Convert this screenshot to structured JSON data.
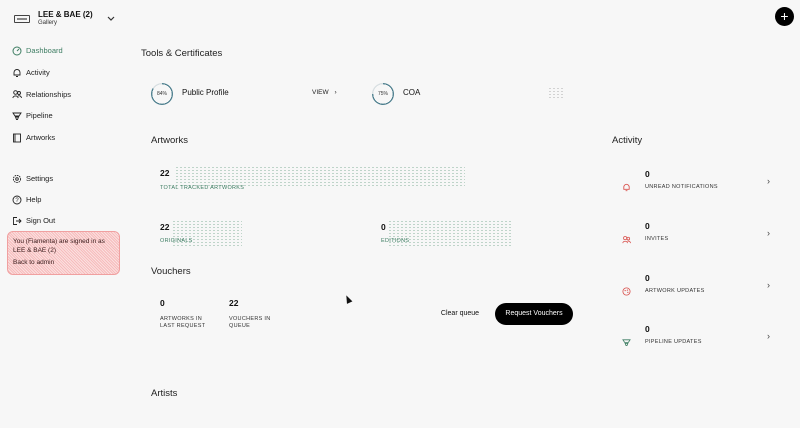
{
  "gallery": {
    "name": "LEE & BAE (2)",
    "subtitle": "Gallery"
  },
  "nav": {
    "primary": [
      {
        "label": "Dashboard",
        "icon": "dashboard-icon",
        "active": true
      },
      {
        "label": "Activity",
        "icon": "bell-icon"
      },
      {
        "label": "Relationships",
        "icon": "users-icon"
      },
      {
        "label": "Pipeline",
        "icon": "pipeline-icon"
      },
      {
        "label": "Artworks",
        "icon": "book-icon"
      }
    ],
    "secondary": [
      {
        "label": "Settings",
        "icon": "gear-icon"
      },
      {
        "label": "Help",
        "icon": "help-icon"
      },
      {
        "label": "Sign Out",
        "icon": "sign-out-icon"
      }
    ]
  },
  "signed_in": {
    "message": "You (Fiamenta) are signed in as LEE & BAE (2)",
    "back_label": "Back to admin"
  },
  "tools": {
    "title": "Tools & Certificates",
    "public_profile": {
      "percent": "84%",
      "percent_value": 84,
      "label": "Public Profile",
      "view_label": "VIEW"
    },
    "coa": {
      "percent": "75%",
      "percent_value": 75,
      "label": "COA"
    }
  },
  "artworks": {
    "title": "Artworks",
    "total": {
      "value": "22",
      "label": "TOTAL TRACKED ARTWORKS"
    },
    "originals": {
      "value": "22",
      "label": "ORIGINALS"
    },
    "editions": {
      "value": "0",
      "label": "EDITIONS"
    }
  },
  "vouchers": {
    "title": "Vouchers",
    "last_request": {
      "value": "0",
      "label_line1": "ARTWORKS IN",
      "label_line2": "LAST REQUEST"
    },
    "in_queue": {
      "value": "22",
      "label_line1": "VOUCHERS IN",
      "label_line2": "QUEUE"
    },
    "clear_label": "Clear queue",
    "request_label": "Request Vouchers"
  },
  "artists": {
    "title": "Artists"
  },
  "activity": {
    "title": "Activity",
    "items": [
      {
        "value": "0",
        "label": "UNREAD NOTIFICATIONS",
        "icon": "bell-icon"
      },
      {
        "value": "0",
        "label": "INVITES",
        "icon": "users-icon"
      },
      {
        "value": "0",
        "label": "ARTWORK UPDATES",
        "icon": "palette-icon"
      },
      {
        "value": "0",
        "label": "PIPELINE UPDATES",
        "icon": "pipeline-icon"
      }
    ]
  },
  "colors": {
    "accent": "#3d7d62",
    "ring": "#4d7f8e",
    "ring_track": "#d8dfe2",
    "alert": "#d9534f"
  }
}
